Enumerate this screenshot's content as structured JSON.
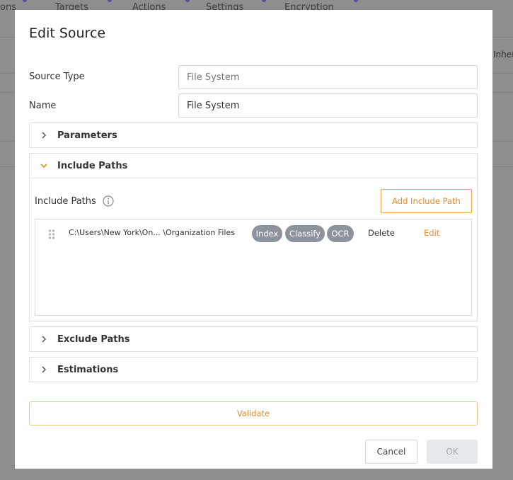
{
  "background": {
    "tabs": [
      "ons",
      "Targets",
      "Actions",
      "Settings",
      "Encryption"
    ],
    "right_text": "Inher"
  },
  "modal": {
    "title": "Edit Source",
    "source_type": {
      "label": "Source Type",
      "placeholder": "File System"
    },
    "name": {
      "label": "Name",
      "value": "File System"
    },
    "sections": {
      "parameters": "Parameters",
      "include_paths": "Include Paths",
      "exclude_paths": "Exclude Paths",
      "estimations": "Estimations"
    },
    "include": {
      "label": "Include Paths",
      "add_button": "Add Include Path",
      "rows": [
        {
          "path": "C:\\Users\\New York\\On... \\Organization Files",
          "badges": [
            "Index",
            "Classify",
            "OCR"
          ],
          "delete": "Delete",
          "edit": "Edit"
        }
      ]
    },
    "validate_button": "Validate",
    "cancel_button": "Cancel",
    "ok_button": "OK"
  },
  "colors": {
    "accent": "#e98a24",
    "badge": "#8c939b",
    "overlay": "#8e8e8e"
  },
  "icons": {
    "collapsed": "chevron-right-icon",
    "expanded": "chevron-down-icon",
    "info": "info-icon",
    "drag": "drag-handle-icon"
  }
}
